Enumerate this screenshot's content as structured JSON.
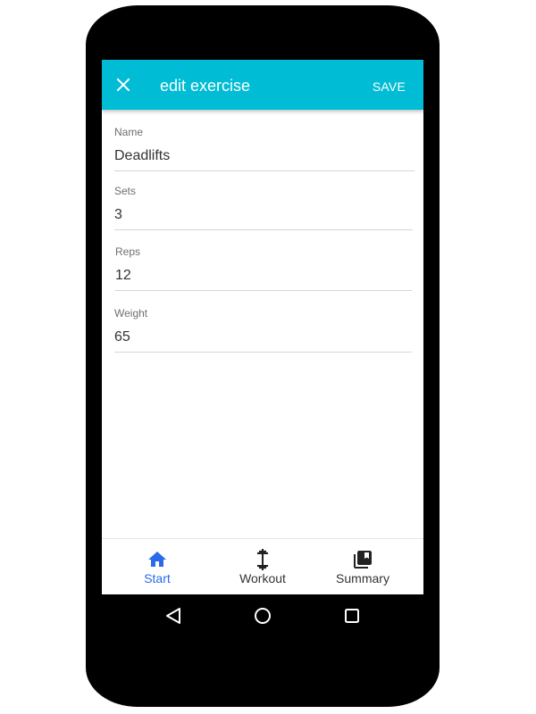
{
  "appbar": {
    "title": "edit exercise",
    "save_label": "SAVE",
    "close_icon": "close-icon",
    "color": "#00bcd4"
  },
  "form": {
    "fields": [
      {
        "label": "Name",
        "value": "Deadlifts"
      },
      {
        "label": "Sets",
        "value": "3"
      },
      {
        "label": "Reps",
        "value": "12"
      },
      {
        "label": "Weight",
        "value": "65"
      }
    ]
  },
  "bottom_nav": {
    "active_color": "#2a6ae8",
    "items": [
      {
        "label": "Start",
        "icon": "home-icon",
        "active": true
      },
      {
        "label": "Workout",
        "icon": "dumbbell-icon",
        "active": false
      },
      {
        "label": "Summary",
        "icon": "library-books-icon",
        "active": false
      }
    ]
  },
  "system_nav": {
    "buttons": [
      "back-icon",
      "home-circle-icon",
      "recents-icon"
    ]
  }
}
